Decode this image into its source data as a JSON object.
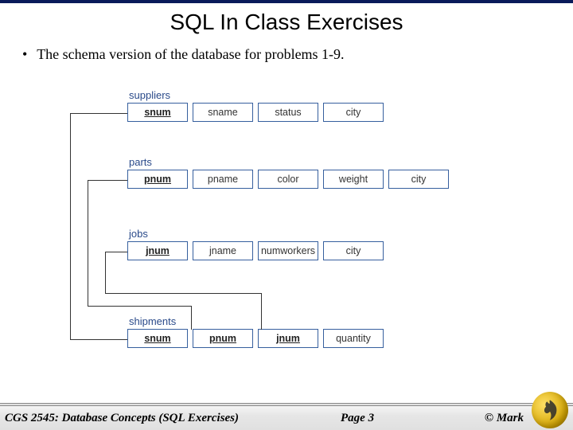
{
  "title": "SQL In Class Exercises",
  "bullet": "The schema version of the database for problems 1-9.",
  "tables": {
    "suppliers": {
      "name": "suppliers",
      "cols": [
        "snum",
        "sname",
        "status",
        "city"
      ],
      "keys": [
        0
      ]
    },
    "parts": {
      "name": "parts",
      "cols": [
        "pnum",
        "pname",
        "color",
        "weight",
        "city"
      ],
      "keys": [
        0
      ]
    },
    "jobs": {
      "name": "jobs",
      "cols": [
        "jnum",
        "jname",
        "numworkers",
        "city"
      ],
      "keys": [
        0
      ]
    },
    "shipments": {
      "name": "shipments",
      "cols": [
        "snum",
        "pnum",
        "jnum",
        "quantity"
      ],
      "keys": [
        0,
        1,
        2
      ]
    }
  },
  "footer": {
    "left": "CGS 2545: Database Concepts  (SQL Exercises)",
    "mid": "Page 3",
    "right": "© Mark"
  }
}
